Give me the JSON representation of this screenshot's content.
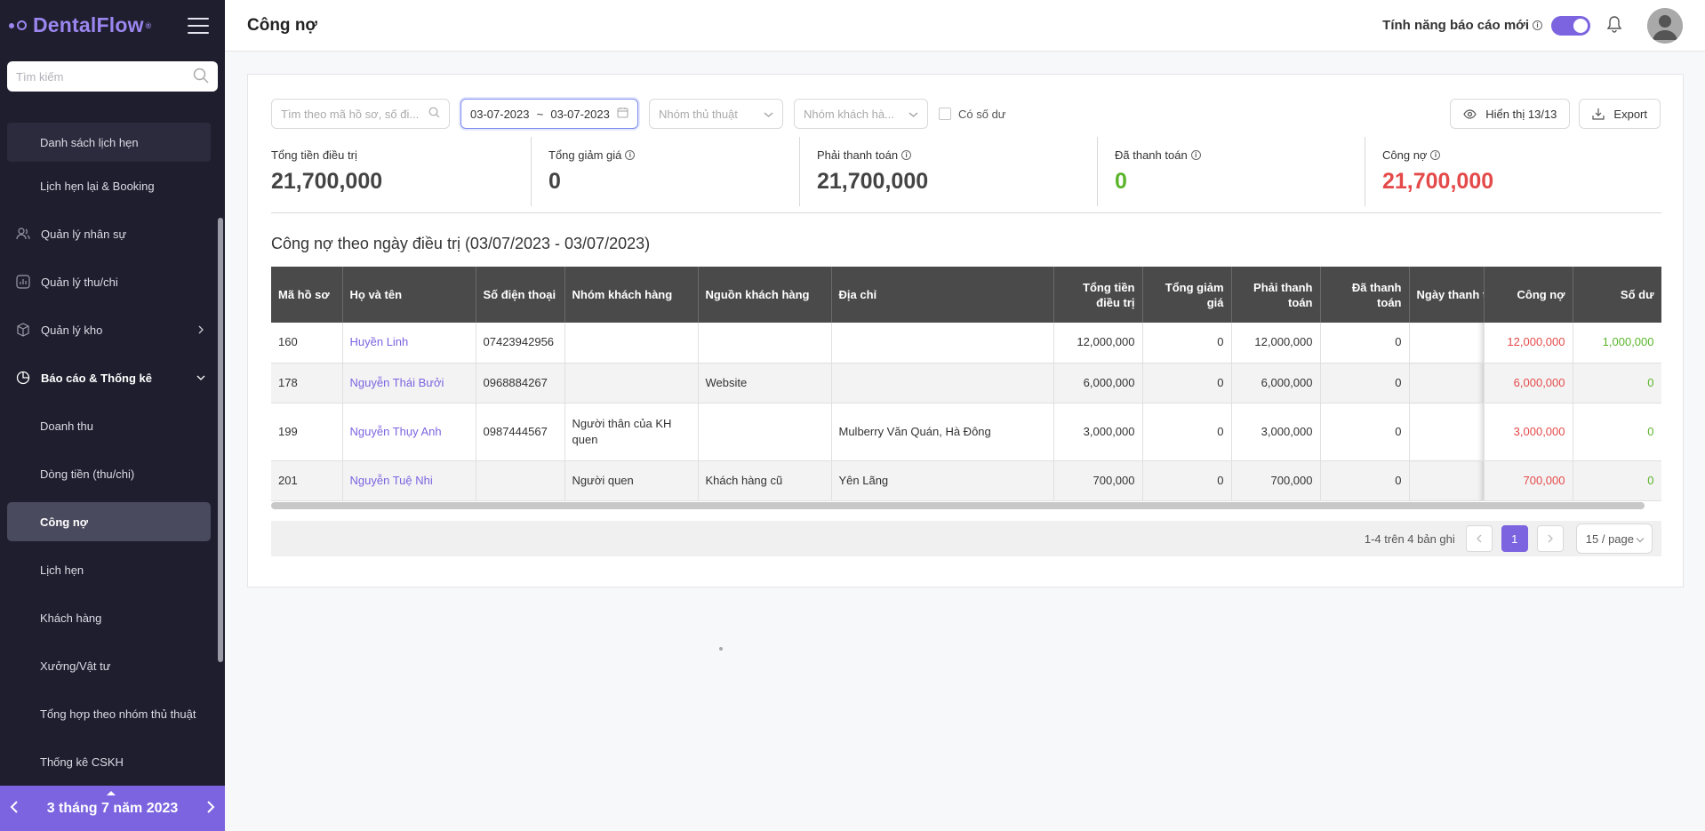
{
  "app": {
    "logo": "DentalFlow",
    "logo_mark": "®"
  },
  "sidebar": {
    "search_placeholder": "Tìm kiếm",
    "items": [
      {
        "label": "Danh sách lịch hẹn"
      },
      {
        "label": "Lịch hẹn lại & Booking"
      },
      {
        "label": "Quản lý nhân sự",
        "icon": "users-icon"
      },
      {
        "label": "Quản lý thu/chi",
        "icon": "chart-box-icon"
      },
      {
        "label": "Quản lý kho",
        "icon": "box-icon"
      },
      {
        "label": "Báo cáo & Thống kê",
        "icon": "pie-chart-icon"
      },
      {
        "label": "Doanh thu"
      },
      {
        "label": "Dòng tiền (thu/chi)"
      },
      {
        "label": "Công nợ"
      },
      {
        "label": "Lịch hẹn"
      },
      {
        "label": "Khách hàng"
      },
      {
        "label": "Xưởng/Vật tư"
      },
      {
        "label": "Tổng hợp theo nhóm thủ thuật"
      },
      {
        "label": "Thống kê CSKH"
      }
    ],
    "current_date": "3 tháng 7 năm 2023"
  },
  "header": {
    "title": "Công nợ",
    "feature_label": "Tính năng báo cáo mới",
    "toggle_on": true
  },
  "filters": {
    "search_placeholder": "Tìm theo mã hồ sơ, số đi...",
    "date_from": "03-07-2023",
    "date_sep": "~",
    "date_to": "03-07-2023",
    "procedure_group_placeholder": "Nhóm thủ thuật",
    "customer_group_placeholder": "Nhóm khách hà...",
    "balance_checkbox": "Có số dư",
    "display_button": "Hiển thị 13/13",
    "export_button": "Export"
  },
  "stats": [
    {
      "label": "Tổng tiền điều trị",
      "value": "21,700,000",
      "info": false
    },
    {
      "label": "Tổng giảm giá",
      "value": "0",
      "info": true
    },
    {
      "label": "Phải thanh toán",
      "value": "21,700,000",
      "info": true
    },
    {
      "label": "Đã thanh toán",
      "value": "0",
      "info": true,
      "color": "#5ab52a"
    },
    {
      "label": "Công nợ",
      "value": "21,700,000",
      "info": true,
      "color": "#e54a4a"
    }
  ],
  "table": {
    "title": "Công nợ theo ngày điều trị (03/07/2023 - 03/07/2023)",
    "columns": [
      "Mã hồ sơ",
      "Họ và tên",
      "Số điện thoại",
      "Nhóm khách hàng",
      "Nguồn khách hàng",
      "Địa chỉ",
      "Tổng tiền điều trị",
      "Tổng giảm giá",
      "Phải thanh toán",
      "Đã thanh toán",
      "Ngày thanh toán gần nhất",
      "Công nợ",
      "Số dư"
    ],
    "rows": [
      {
        "id": "160",
        "name": "Huyền Linh",
        "phone": "07423942956",
        "group": "",
        "source": "",
        "address": "",
        "total": "12,000,000",
        "discount": "0",
        "payable": "12,000,000",
        "paid": "0",
        "last_paid": "",
        "debt": "12,000,000",
        "balance": "1,000,000"
      },
      {
        "id": "178",
        "name": "Nguyễn Thái Bưởi",
        "phone": "0968884267",
        "group": "",
        "source": "Website",
        "address": "",
        "total": "6,000,000",
        "discount": "0",
        "payable": "6,000,000",
        "paid": "0",
        "last_paid": "",
        "debt": "6,000,000",
        "balance": "0"
      },
      {
        "id": "199",
        "name": "Nguyễn Thụy Anh",
        "phone": "0987444567",
        "group": "Người thân của KH quen",
        "source": "",
        "address": "Mulberry Văn Quán, Hà Đông",
        "total": "3,000,000",
        "discount": "0",
        "payable": "3,000,000",
        "paid": "0",
        "last_paid": "",
        "debt": "3,000,000",
        "balance": "0"
      },
      {
        "id": "201",
        "name": "Nguyễn Tuệ Nhi",
        "phone": "",
        "group": "Người quen",
        "source": "Khách hàng cũ",
        "address": "Yên Lãng",
        "total": "700,000",
        "discount": "0",
        "payable": "700,000",
        "paid": "0",
        "last_paid": "",
        "debt": "700,000",
        "balance": "0"
      }
    ]
  },
  "pagination": {
    "summary": "1-4 trên 4 bản ghi",
    "current_page": "1",
    "page_size": "15 / page"
  }
}
